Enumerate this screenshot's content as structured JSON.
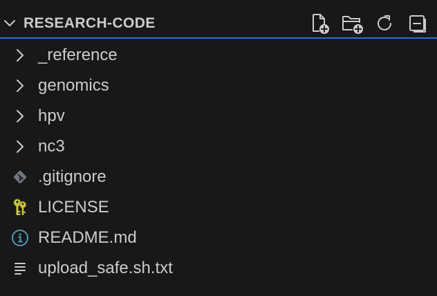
{
  "explorer": {
    "title": "RESEARCH-CODE",
    "actions": [
      {
        "name": "new-file-button",
        "icon": "new-file-icon"
      },
      {
        "name": "new-folder-button",
        "icon": "new-folder-icon"
      },
      {
        "name": "refresh-button",
        "icon": "refresh-icon"
      },
      {
        "name": "collapse-all-button",
        "icon": "collapse-all-icon"
      }
    ],
    "items": [
      {
        "label": "_reference",
        "kind": "folder",
        "icon": "chevron-right-icon"
      },
      {
        "label": "genomics",
        "kind": "folder",
        "icon": "chevron-right-icon"
      },
      {
        "label": "hpv",
        "kind": "folder",
        "icon": "chevron-right-icon"
      },
      {
        "label": "nc3",
        "kind": "folder",
        "icon": "chevron-right-icon"
      },
      {
        "label": ".gitignore",
        "kind": "file",
        "icon": "git-icon"
      },
      {
        "label": "LICENSE",
        "kind": "file",
        "icon": "license-key-icon"
      },
      {
        "label": "README.md",
        "kind": "file",
        "icon": "info-icon"
      },
      {
        "label": "upload_safe.sh.txt",
        "kind": "file",
        "icon": "text-file-icon"
      }
    ]
  },
  "colors": {
    "background": "#181818",
    "text": "#cccccc",
    "focus_border": "#2a6fd6",
    "git_icon": "#6e7681",
    "license_icon": "#cbcb41",
    "info_icon": "#519aba"
  }
}
